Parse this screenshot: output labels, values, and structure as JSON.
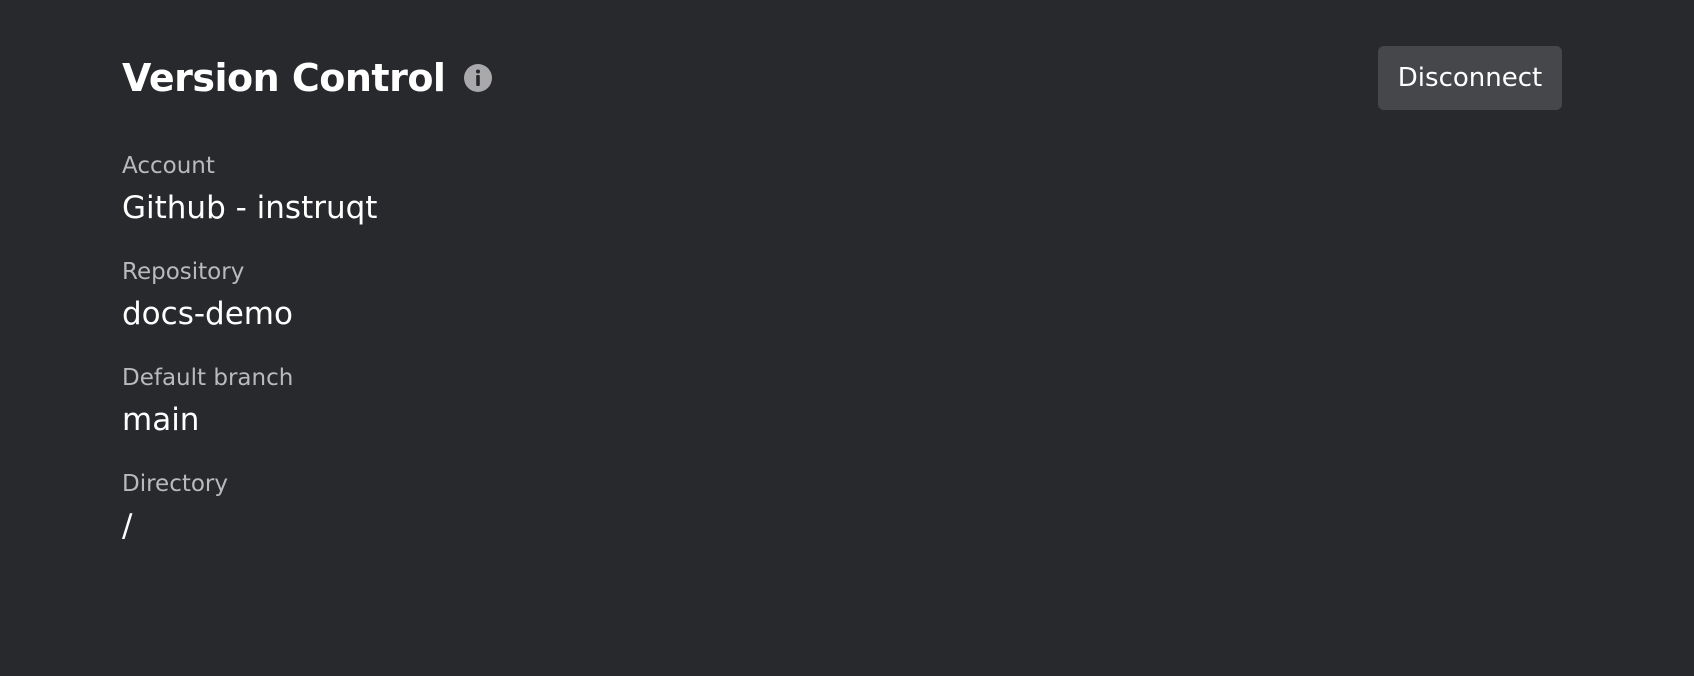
{
  "header": {
    "title": "Version Control",
    "info_icon": "info-icon",
    "disconnect_label": "Disconnect"
  },
  "fields": [
    {
      "label": "Account",
      "value": "Github - instruqt"
    },
    {
      "label": "Repository",
      "value": "docs-demo"
    },
    {
      "label": "Default branch",
      "value": "main"
    },
    {
      "label": "Directory",
      "value": "/"
    }
  ],
  "colors": {
    "background": "#28292d",
    "button_bg": "#46474b",
    "label_text": "#b9babd",
    "value_text": "#ffffff",
    "icon": "#a9a9ac"
  }
}
